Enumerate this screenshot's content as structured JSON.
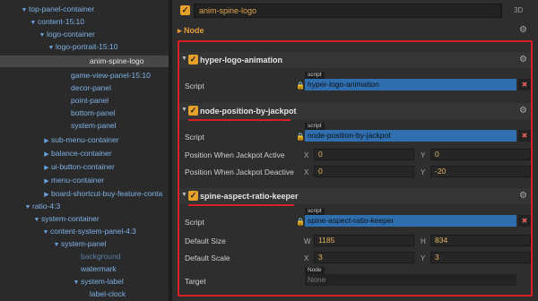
{
  "hierarchy": {
    "rows": [
      {
        "label": "top-panel-container",
        "expanded": true
      },
      {
        "label": "content-15:10",
        "expanded": true
      },
      {
        "label": "logo-container",
        "expanded": true
      },
      {
        "label": "logo-portrait-15:10",
        "expanded": true
      },
      {
        "label": "anim-spine-logo",
        "expanded": null,
        "selected": true
      },
      {
        "label": "game-view-panel-15:10",
        "expanded": null
      },
      {
        "label": "decor-panel",
        "expanded": null
      },
      {
        "label": "point-panel",
        "expanded": null
      },
      {
        "label": "bottom-panel",
        "expanded": null
      },
      {
        "label": "system-panel",
        "expanded": null
      },
      {
        "label": "sub-menu-container",
        "expanded": false
      },
      {
        "label": "balance-container",
        "expanded": false
      },
      {
        "label": "ui-button-container",
        "expanded": false
      },
      {
        "label": "menu-container",
        "expanded": false
      },
      {
        "label": "board-shortcut-buy-feature-conta",
        "expanded": false
      },
      {
        "label": "ratio-4:3",
        "expanded": true
      },
      {
        "label": "system-container",
        "expanded": true
      },
      {
        "label": "content-system-panel-4:3",
        "expanded": true
      },
      {
        "label": "system-panel",
        "expanded": true
      },
      {
        "label": "background",
        "expanded": null,
        "dim": true
      },
      {
        "label": "watermark",
        "expanded": null
      },
      {
        "label": "system-label",
        "expanded": true
      },
      {
        "label": "label-clock",
        "expanded": null
      }
    ]
  },
  "inspector": {
    "node_name": "anim-spine-logo",
    "mode_label": "3D",
    "node_section_label": "Node",
    "components": [
      {
        "title": "hyper-logo-animation",
        "props": [
          {
            "label": "Script",
            "tag": "script",
            "value": "hyper-logo-animation"
          }
        ]
      },
      {
        "title": "node-position-by-jackpot",
        "props": [
          {
            "label": "Script",
            "tag": "script",
            "value": "node-position-by-jackpot"
          },
          {
            "label": "Position When Jackpot Active",
            "x": "0",
            "y": "0"
          },
          {
            "label": "Position When Jackpot Deactive",
            "x": "0",
            "y": "-20"
          }
        ]
      },
      {
        "title": "spine-aspect-ratio-keeper",
        "props": [
          {
            "label": "Script",
            "tag": "script",
            "value": "spine-aspect-ratio-keeper"
          },
          {
            "label": "Default Size",
            "w": "1185",
            "h": "834"
          },
          {
            "label": "Default Scale",
            "x": "3",
            "y": "3"
          },
          {
            "label": "Target",
            "tag": "Node",
            "value": "None"
          }
        ]
      }
    ],
    "axis": {
      "x": "X",
      "y": "Y",
      "w": "W",
      "h": "H"
    },
    "colors": {
      "accent_checkbox": "#e6a12a",
      "highlight_border": "#d81f26",
      "ref_field": "#2f6fb0"
    }
  }
}
